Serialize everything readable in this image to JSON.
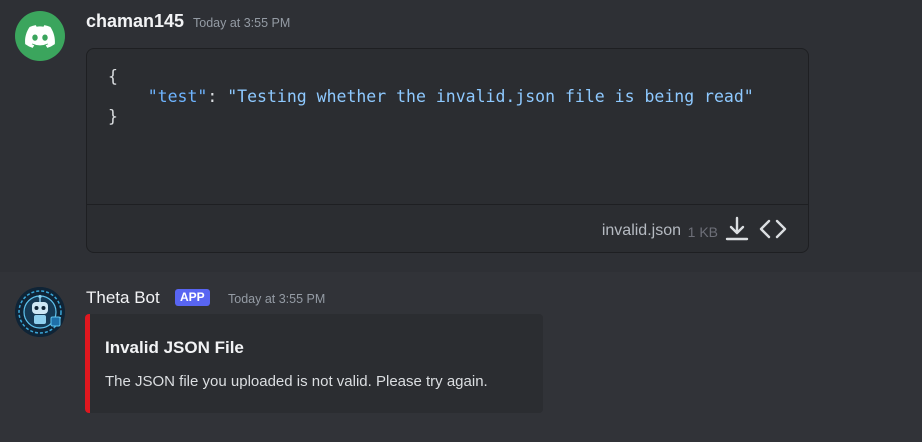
{
  "message1": {
    "author": "chaman145",
    "timestamp": "Today at 3:55 PM",
    "avatar_icon": "discord-logo-icon",
    "attachment": {
      "code_open": "{",
      "code_key": "\"test\"",
      "code_colon": ": ",
      "code_value": "\"Testing whether the invalid.json file is being read\"",
      "code_close": "}",
      "filename": "invalid.json",
      "filesize": "1 KB",
      "download_icon": "download-icon",
      "view_icon": "code-brackets-icon"
    }
  },
  "message2": {
    "author": "Theta Bot",
    "badge": "APP",
    "timestamp": "Today at 3:55 PM",
    "avatar_icon": "robot-avatar-icon",
    "embed": {
      "title": "Invalid JSON File",
      "description": "The JSON file you uploaded is not valid. Please try again.",
      "accent_color": "#e0171f"
    }
  },
  "colors": {
    "background": "#313338",
    "message_hover": "#2e3035",
    "brand": "#5865f2",
    "discord_green": "#3ba55d"
  }
}
